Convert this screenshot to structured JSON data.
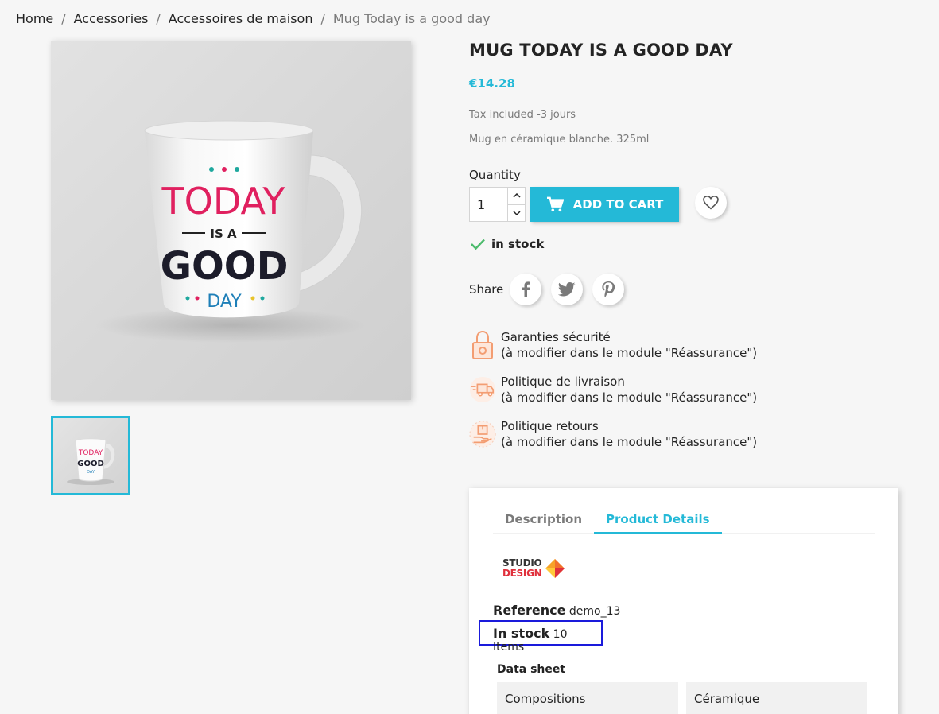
{
  "breadcrumb": {
    "items": [
      "Home",
      "Accessories",
      "Accessoires de maison"
    ],
    "current": "Mug Today is a good day",
    "separator": "/"
  },
  "product": {
    "title": "MUG TODAY IS A GOOD DAY",
    "price": "€14.28",
    "tax_note": "Tax included  -3 jours",
    "short_description": "Mug en céramique blanche. 325ml",
    "mug_print": {
      "line1": "TODAY",
      "line2": "IS A",
      "line3": "GOOD",
      "line4": "DAY"
    }
  },
  "purchase": {
    "quantity_label": "Quantity",
    "quantity_value": "1",
    "add_to_cart_label": "ADD TO CART",
    "stock_status": "in stock"
  },
  "share": {
    "label": "Share",
    "networks": [
      "facebook-icon",
      "twitter-icon",
      "pinterest-icon"
    ]
  },
  "reassurance": [
    {
      "title": "Garanties sécurité",
      "subtitle": "(à modifier dans le module \"Réassurance\")",
      "icon": "lock-icon"
    },
    {
      "title": "Politique de livraison",
      "subtitle": "(à modifier dans le module \"Réassurance\")",
      "icon": "truck-icon"
    },
    {
      "title": "Politique retours",
      "subtitle": "(à modifier dans le module \"Réassurance\")",
      "icon": "return-box-icon"
    }
  ],
  "tabs": {
    "items": [
      "Description",
      "Product Details"
    ],
    "active": "Product Details"
  },
  "details": {
    "brand_line1": "STUDIO",
    "brand_line2": "DESIGN",
    "reference_label": "Reference",
    "reference_value": "demo_13",
    "instock_label": "In stock",
    "instock_value": "10 Items",
    "datasheet_title": "Data sheet",
    "datasheet_rows": [
      {
        "name": "Compositions",
        "value": "Céramique"
      }
    ]
  },
  "colors": {
    "accent": "#24b9d7",
    "success": "#4cbb6c",
    "reassurance": "#f39d72",
    "highlight_box": "#1a1adb"
  }
}
